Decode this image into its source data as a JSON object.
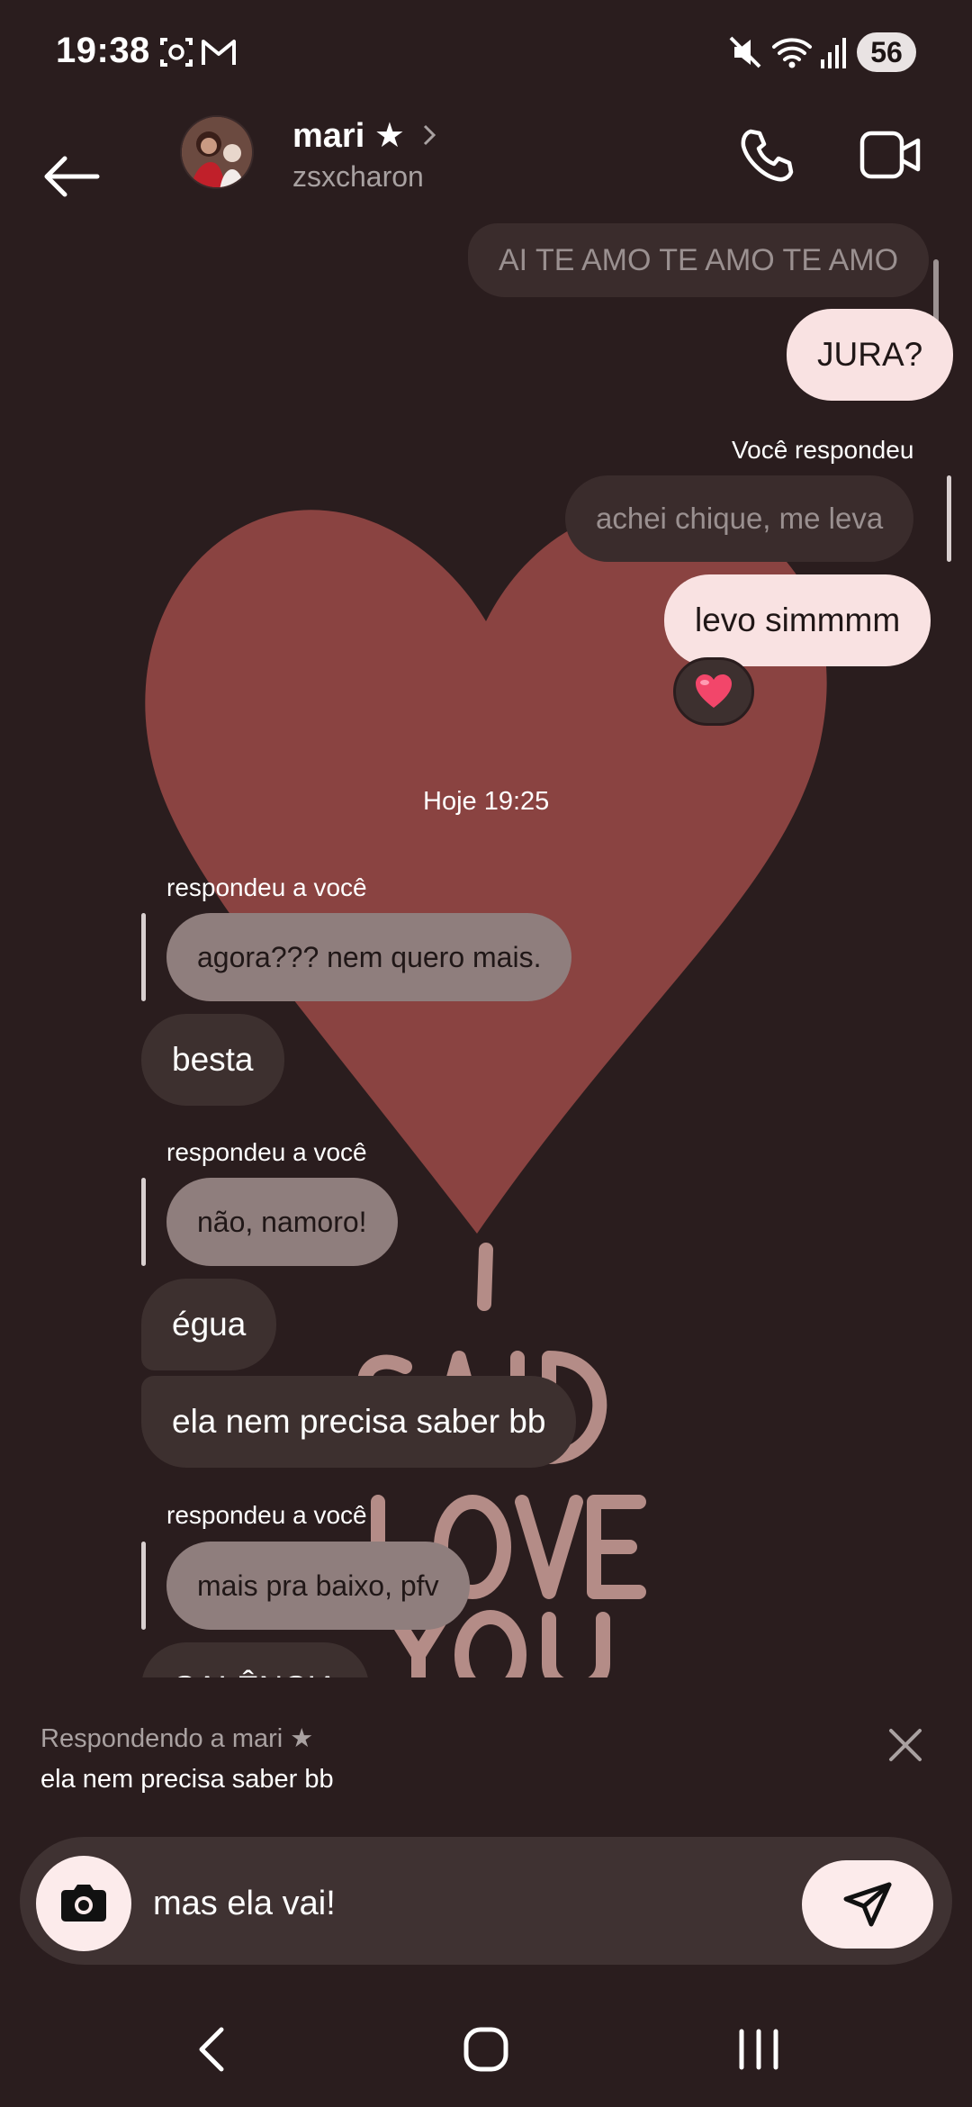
{
  "status_bar": {
    "time": "19:38",
    "battery": "56",
    "icons": [
      "screenshot-icon",
      "gmail-icon",
      "mute-icon",
      "wifi-icon",
      "signal-icon"
    ]
  },
  "header": {
    "name": "mari ★",
    "username": "zsxcharon",
    "icons": [
      "back-arrow-icon",
      "chevron-right-icon",
      "phone-icon",
      "video-icon"
    ]
  },
  "background_art": {
    "heart_color": "#8a4341",
    "text": "I SAID I LOVE YOU",
    "text_color": "#b48c87"
  },
  "messages": {
    "m1": "AI TE AMO TE AMO TE AMO",
    "m2": "JURA?",
    "m3_label": "Você respondeu",
    "m3_quote": "achei chique, me leva",
    "m4": "levo simmmm",
    "m4_reaction": "❤️",
    "timestamp": "Hoje 19:25",
    "m5_label": "respondeu a você",
    "m5_quote": "agora??? nem quero mais.",
    "m6": "besta",
    "m7_label": "respondeu a você",
    "m7_quote": "não, namoro!",
    "m8": "égua",
    "m9": "ela nem precisa saber bb",
    "m10_label": "respondeu a você",
    "m10_quote": "mais pra baixo, pfv",
    "m11_partial": "CALÊNCIA"
  },
  "replying": {
    "title": "Respondendo a mari ★",
    "text": "ela nem precisa saber bb"
  },
  "composer": {
    "value": "mas ela vai!"
  },
  "colors": {
    "background": "#2a1d1e",
    "sent_bubble": "#f9e2e2",
    "received_bubble": "#3d302f",
    "quoted_bubble": "#8f7e7d"
  }
}
